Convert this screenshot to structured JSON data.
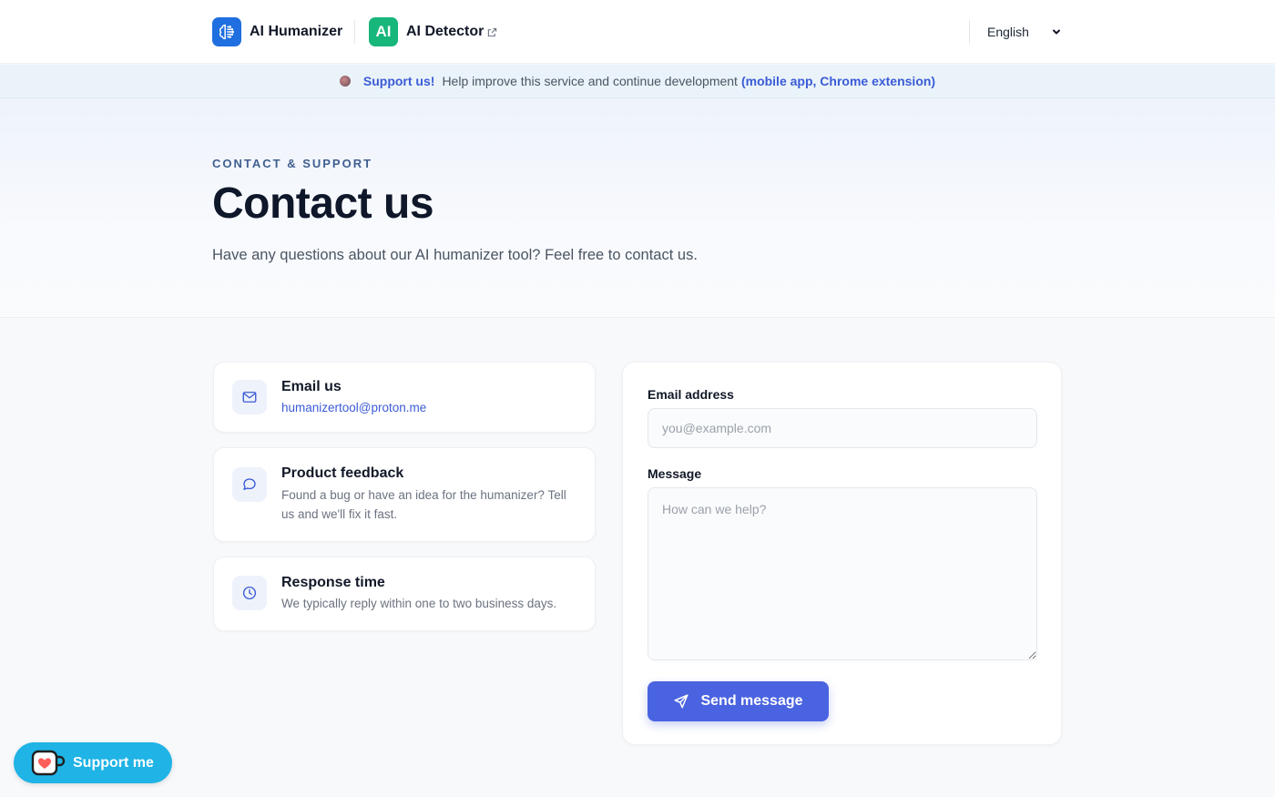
{
  "header": {
    "humanizer_label": "AI Humanizer",
    "detector_logo_text": "AI",
    "detector_label": "AI Detector",
    "language": "English"
  },
  "banner": {
    "support_label": "Support us!",
    "text": "Help improve this service and continue development",
    "link_text": "(mobile app, Chrome extension)"
  },
  "hero": {
    "eyebrow": "CONTACT & SUPPORT",
    "title": "Contact us",
    "subtitle": "Have any questions about our AI humanizer tool? Feel free to contact us."
  },
  "cards": [
    {
      "title": "Email us",
      "link": "humanizertool@proton.me",
      "icon": "mail-icon"
    },
    {
      "title": "Product feedback",
      "body": "Found a bug or have an idea for the humanizer? Tell us and we'll fix it fast.",
      "icon": "chat-bubble-icon"
    },
    {
      "title": "Response time",
      "body": "We typically reply within one to two business days.",
      "icon": "clock-icon"
    }
  ],
  "form": {
    "email_label": "Email address",
    "email_placeholder": "you@example.com",
    "email_value": "",
    "message_label": "Message",
    "message_placeholder": "How can we help?",
    "message_value": "",
    "submit_label": "Send message"
  },
  "floating": {
    "support_label": "Support me"
  },
  "colors": {
    "accent": "#4a63e0",
    "link": "#3b5bd6",
    "humanizer_logo": "#1f6fe0",
    "detector_logo": "#17b67a",
    "support_fab": "#1fb3e6",
    "banner_bg": "#eaf3f9"
  }
}
